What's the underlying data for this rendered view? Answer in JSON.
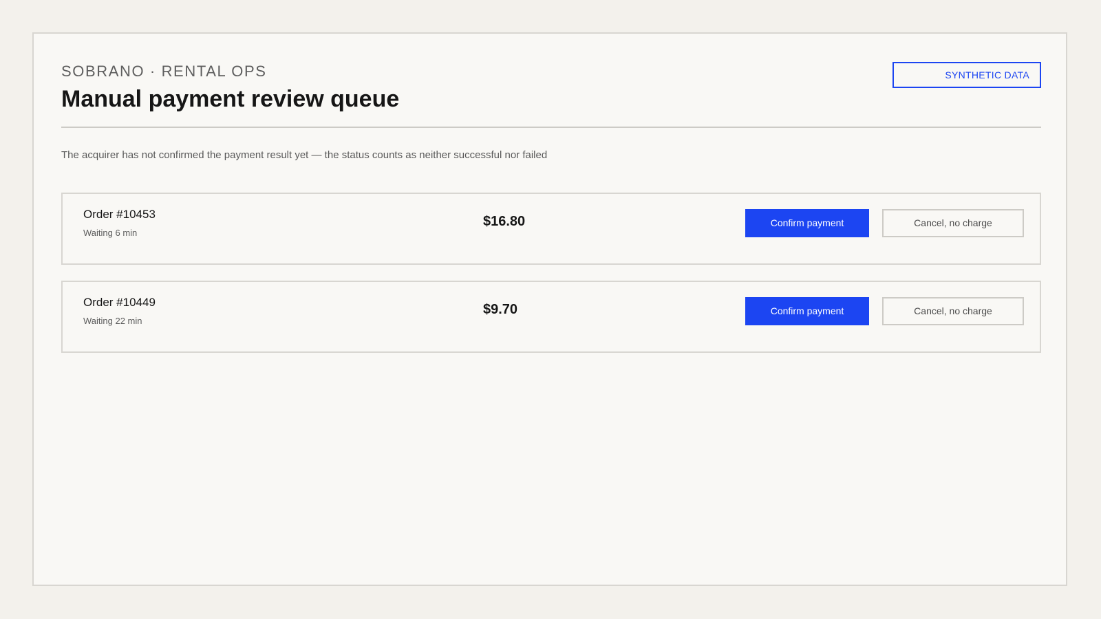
{
  "header": {
    "brand": "SOBRANO · RENTAL OPS",
    "title": "Manual payment review queue",
    "badge": "SYNTHETIC DATA"
  },
  "status_note": "The acquirer has not confirmed the payment result yet — the status counts as neither successful nor failed",
  "queue": {
    "rows": [
      {
        "order": "Order #10453",
        "waiting": "Waiting 6 min",
        "amount": "$16.80",
        "confirm_label": "Confirm payment",
        "cancel_label": "Cancel, no charge"
      },
      {
        "order": "Order #10449",
        "waiting": "Waiting 22 min",
        "amount": "$9.70",
        "confirm_label": "Confirm payment",
        "cancel_label": "Cancel, no charge"
      }
    ]
  },
  "colors": {
    "accent": "#1c45f2",
    "background": "#f3f1ec",
    "panel": "#f9f8f5",
    "text": "#161616"
  }
}
